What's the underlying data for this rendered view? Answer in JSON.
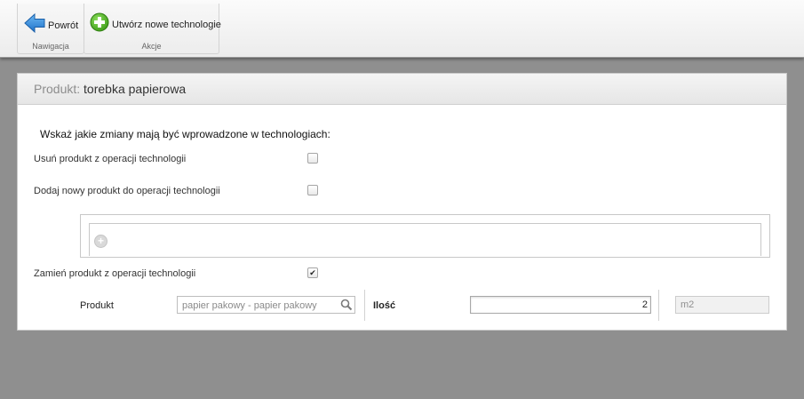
{
  "ribbon": {
    "back_label": "Powrót",
    "create_label": "Utwórz nowe technologie",
    "nav_group_label": "Nawigacja",
    "actions_group_label": "Akcje",
    "back_icon_color": "#2a86d8",
    "create_icon_color": "#4caf22"
  },
  "form": {
    "header_key": "Produkt:",
    "header_value": "torebka papierowa",
    "instruction": "Wskaż jakie zmiany mają być wprowadzone w technologiach:",
    "remove_label": "Usuń produkt z operacji technologii",
    "remove_checked": false,
    "add_label": "Dodaj nowy produkt do operacji technologii",
    "add_checked": false,
    "replace_label": "Zamień produkt z operacji technologii",
    "replace_checked": true,
    "product_label": "Produkt",
    "product_value": "papier pakowy - papier pakowy",
    "quantity_label": "Ilość",
    "quantity_value": "2",
    "unit_value": "m2"
  },
  "icons": {
    "back": "arrow-left-icon",
    "create": "plus-circle-icon",
    "add_row": "add-row-icon",
    "lookup": "magnifier-icon"
  }
}
